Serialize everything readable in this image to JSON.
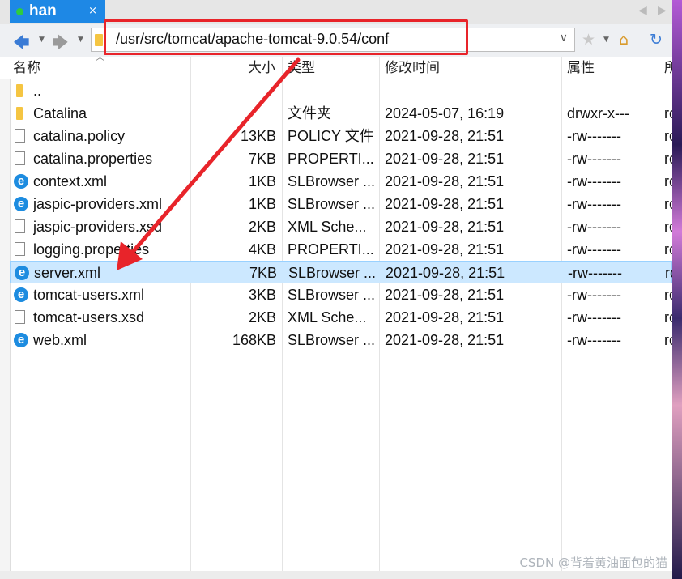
{
  "tab": {
    "label": "han",
    "close": "×"
  },
  "toolbar": {
    "back": "🡄",
    "forward": "🡆",
    "path": "/usr/src/tomcat/apache-tomcat-9.0.54/conf",
    "dropdown": "∨"
  },
  "columns": {
    "name": "名称",
    "size": "大小",
    "type": "类型",
    "modified": "修改时间",
    "attrs": "属性",
    "owner": "所"
  },
  "files": [
    {
      "name": "..",
      "size": "",
      "type": "",
      "modified": "",
      "attrs": "",
      "owner": "",
      "icon": "folder-icon"
    },
    {
      "name": "Catalina",
      "size": "",
      "type": "文件夹",
      "modified": "2024-05-07, 16:19",
      "attrs": "drwxr-x---",
      "owner": "ro",
      "icon": "folder-icon"
    },
    {
      "name": "catalina.policy",
      "size": "13KB",
      "type": "POLICY 文件",
      "modified": "2021-09-28, 21:51",
      "attrs": "-rw-------",
      "owner": "ro",
      "icon": "file-icon"
    },
    {
      "name": "catalina.properties",
      "size": "7KB",
      "type": "PROPERTI...",
      "modified": "2021-09-28, 21:51",
      "attrs": "-rw-------",
      "owner": "ro",
      "icon": "file-icon"
    },
    {
      "name": "context.xml",
      "size": "1KB",
      "type": "SLBrowser ...",
      "modified": "2021-09-28, 21:51",
      "attrs": "-rw-------",
      "owner": "ro",
      "icon": "browser-icon"
    },
    {
      "name": "jaspic-providers.xml",
      "size": "1KB",
      "type": "SLBrowser ...",
      "modified": "2021-09-28, 21:51",
      "attrs": "-rw-------",
      "owner": "ro",
      "icon": "browser-icon"
    },
    {
      "name": "jaspic-providers.xsd",
      "size": "2KB",
      "type": "XML Sche...",
      "modified": "2021-09-28, 21:51",
      "attrs": "-rw-------",
      "owner": "ro",
      "icon": "file-icon"
    },
    {
      "name": "logging.properties",
      "size": "4KB",
      "type": "PROPERTI...",
      "modified": "2021-09-28, 21:51",
      "attrs": "-rw-------",
      "owner": "ro",
      "icon": "file-icon"
    },
    {
      "name": "server.xml",
      "size": "7KB",
      "type": "SLBrowser ...",
      "modified": "2021-09-28, 21:51",
      "attrs": "-rw-------",
      "owner": "ro",
      "icon": "browser-icon",
      "selected": true
    },
    {
      "name": "tomcat-users.xml",
      "size": "3KB",
      "type": "SLBrowser ...",
      "modified": "2021-09-28, 21:51",
      "attrs": "-rw-------",
      "owner": "ro",
      "icon": "browser-icon"
    },
    {
      "name": "tomcat-users.xsd",
      "size": "2KB",
      "type": "XML Sche...",
      "modified": "2021-09-28, 21:51",
      "attrs": "-rw-------",
      "owner": "ro",
      "icon": "file-icon"
    },
    {
      "name": "web.xml",
      "size": "168KB",
      "type": "SLBrowser ...",
      "modified": "2021-09-28, 21:51",
      "attrs": "-rw-------",
      "owner": "ro",
      "icon": "browser-icon"
    }
  ],
  "watermark": "CSDN @背着黄油面包的猫",
  "colors": {
    "tab": "#1e88e5",
    "highlight": "#e8242a",
    "selection": "#cce8ff"
  }
}
